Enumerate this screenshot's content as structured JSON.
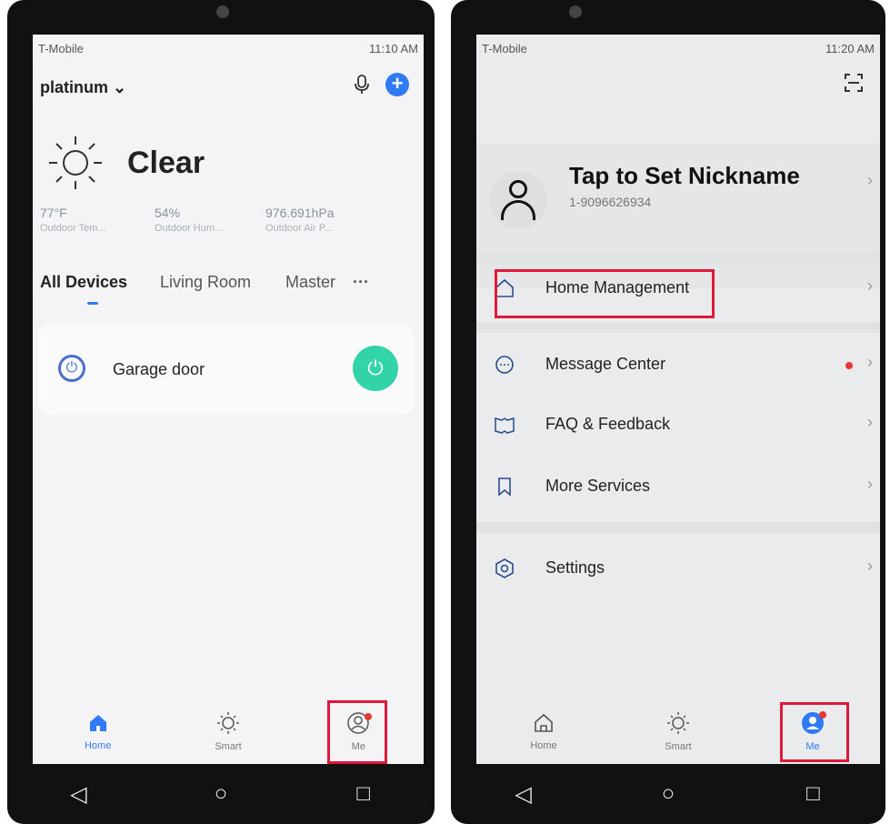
{
  "left_phone": {
    "status": {
      "carrier": "T-Mobile",
      "time": "11:10 AM"
    },
    "home_selector": "platinum ⌄",
    "icons": {
      "mic": "microphone-icon",
      "add": "add-icon",
      "weather": "sun-icon"
    },
    "weather": {
      "condition": "Clear"
    },
    "stats": [
      {
        "value": "77°F",
        "label": "Outdoor Tem..."
      },
      {
        "value": "54%",
        "label": "Outdoor Hum..."
      },
      {
        "value": "976.691hPa",
        "label": "Outdoor Air P..."
      }
    ],
    "tabs": [
      "All Devices",
      "Living Room",
      "Master",
      "···"
    ],
    "device": {
      "name": "Garage door"
    },
    "tabbar": [
      {
        "label": "Home",
        "icon": "home-icon"
      },
      {
        "label": "Smart",
        "icon": "sun-icon"
      },
      {
        "label": "Me",
        "icon": "user-icon"
      }
    ]
  },
  "right_phone": {
    "status": {
      "carrier": "T-Mobile",
      "time": "11:20 AM"
    },
    "profile": {
      "nickname": "Tap to Set Nickname",
      "phone": "1-9096626934"
    },
    "menu": [
      {
        "label": "Home Management",
        "icon": "home-outline-icon"
      },
      {
        "label": "Message Center",
        "icon": "chat-icon"
      },
      {
        "label": "FAQ & Feedback",
        "icon": "book-icon"
      },
      {
        "label": "More Services",
        "icon": "bookmark-icon"
      },
      {
        "label": "Settings",
        "icon": "settings-hex-icon"
      }
    ],
    "tabbar": [
      {
        "label": "Home",
        "icon": "home-outline-icon"
      },
      {
        "label": "Smart",
        "icon": "sun-icon"
      },
      {
        "label": "Me",
        "icon": "user-filled-icon"
      }
    ]
  },
  "colors": {
    "accent": "#2f7bf5",
    "highlight": "#e0183a",
    "power": "#33d3a8"
  }
}
